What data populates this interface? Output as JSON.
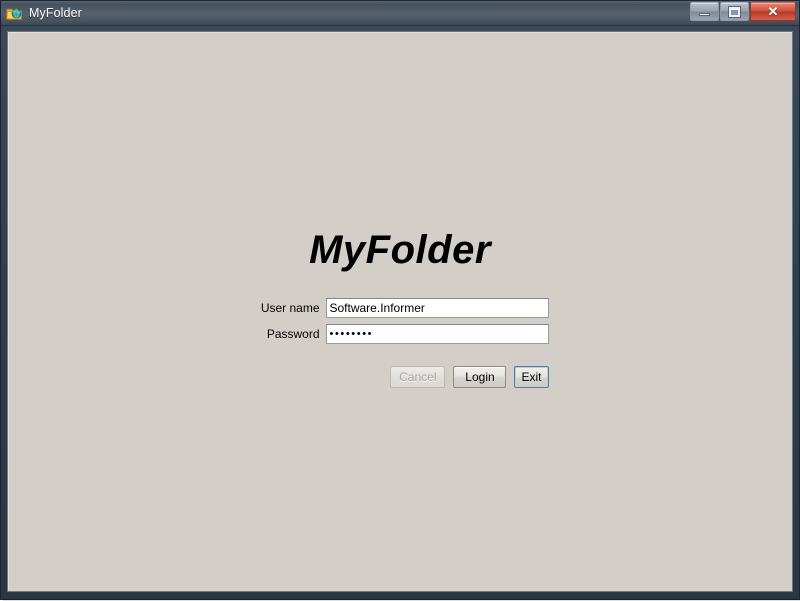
{
  "window": {
    "title": "MyFolder",
    "icon": "folder-globe-icon",
    "frame_color": "#30404f",
    "client_bg": "#d3cfc8",
    "controls": {
      "minimize_label": "Minimize",
      "maximize_label": "Maximize",
      "close_label": "Close",
      "close_glyph": "✕",
      "close_color": "#c4432f"
    }
  },
  "login": {
    "heading": "MyFolder",
    "fields": [
      {
        "label": "User name",
        "value": "Software.Informer",
        "placeholder": "",
        "type": "text",
        "name": "username"
      },
      {
        "label": "Password",
        "value": "••••••••",
        "placeholder": "",
        "type": "password",
        "name": "password",
        "masked_char_count": 8
      }
    ],
    "buttons": [
      {
        "label": "Cancel",
        "state": "disabled",
        "name": "cancel"
      },
      {
        "label": "Login",
        "state": "normal",
        "name": "login"
      },
      {
        "label": "Exit",
        "state": "focused",
        "name": "exit"
      }
    ]
  }
}
